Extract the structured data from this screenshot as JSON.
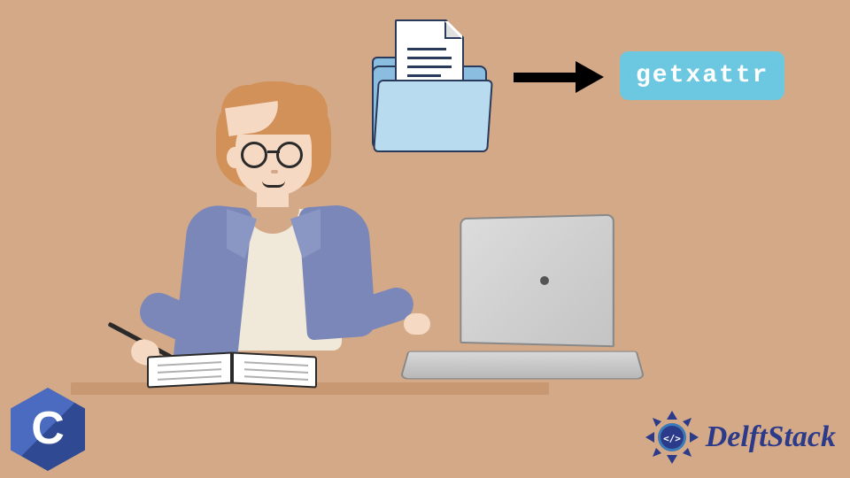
{
  "badge": {
    "function_name": "getxattr"
  },
  "icons": {
    "folder": "folder-with-document-icon",
    "arrow": "right-arrow-icon"
  },
  "logos": {
    "c_lang": {
      "letter": "C"
    },
    "delftstack": {
      "text": "DelftStack",
      "code_symbol": "</>"
    }
  },
  "illustration": {
    "description": "person-at-laptop-with-notebook"
  }
}
